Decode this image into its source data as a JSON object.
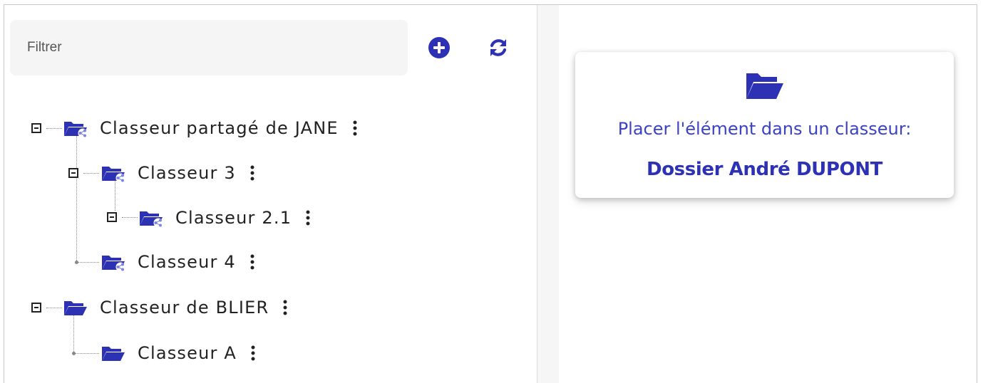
{
  "filter": {
    "placeholder": "Filtrer",
    "value": ""
  },
  "toolbar": {
    "add_icon": "plus-circle-icon",
    "refresh_icon": "refresh-icon"
  },
  "colors": {
    "accent": "#2d32b4",
    "accent_light": "#3b42c4",
    "shared_badge": "#7b83e6"
  },
  "tree": [
    {
      "label": "Classeur partagé de JANE",
      "shared": true,
      "expanded": true,
      "children": [
        {
          "label": "Classeur 3",
          "shared": true,
          "expanded": true,
          "children": [
            {
              "label": "Classeur 2.1",
              "shared": true,
              "expanded": true
            }
          ]
        },
        {
          "label": "Classeur 4",
          "shared": true
        }
      ]
    },
    {
      "label": "Classeur de BLIER",
      "shared": false,
      "expanded": true,
      "children": [
        {
          "label": "Classeur A",
          "shared": false
        }
      ]
    }
  ],
  "card": {
    "icon": "folder-open-icon",
    "instruction": "Placer l'élément dans un classeur:",
    "target": "Dossier André DUPONT"
  }
}
